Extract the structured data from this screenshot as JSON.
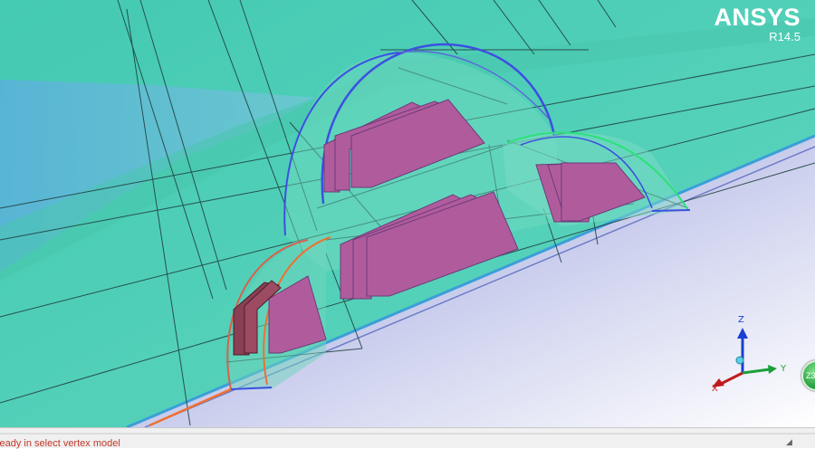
{
  "branding": {
    "product": "ANSYS",
    "version": "R14.5"
  },
  "triad": {
    "z_label": "Z",
    "y_label": "Y",
    "x_label": "X",
    "iso_label": "Z3"
  },
  "status": {
    "message": "keady in select vertex model"
  },
  "colors": {
    "background_top": "#2fb8a0",
    "solid_fill": "#5ecfb6",
    "water": "#5ab7d6",
    "slab": "#a8aedc",
    "arch_edge_blue": "#3d4fe0",
    "arch_edge_green": "#2ee07a",
    "arch_edge_orange": "#f07030",
    "block_fill": "#b05c9c",
    "brand_text": "#ffffff",
    "status_text": "#c0392b"
  },
  "icons": [
    "axis-triad-icon",
    "iso-view-icon",
    "scroll-grip-icon"
  ]
}
